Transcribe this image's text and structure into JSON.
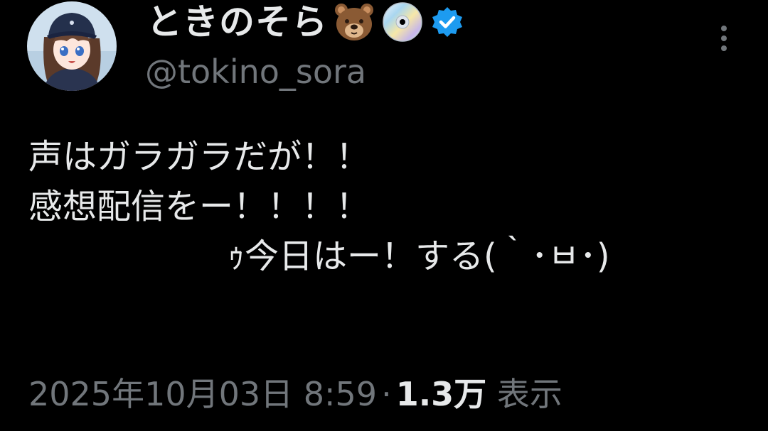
{
  "user": {
    "display_name": "ときのそら",
    "handle": "@tokino_sora",
    "name_emojis": [
      "bear-face-emoji",
      "dvd-disc-emoji"
    ],
    "verified": true,
    "avatar_icon": "avatar-anime-girl-cap"
  },
  "tweet": {
    "lines": [
      "声はガラガラだが！！",
      "感想配信をー！！！！",
      "ｩ今日はー！する(｀･ㅂ･)"
    ]
  },
  "meta": {
    "date_time": "2025年10月03日 8:59",
    "separator": "·",
    "views_count": "1.3万",
    "views_label": "表示"
  },
  "colors": {
    "background": "#000000",
    "text_primary": "#e7e9ea",
    "text_secondary": "#71767b",
    "verified_blue": "#1d9bf0"
  },
  "icons": {
    "more": "more-vertical-icon",
    "verified": "verified-badge-icon"
  }
}
